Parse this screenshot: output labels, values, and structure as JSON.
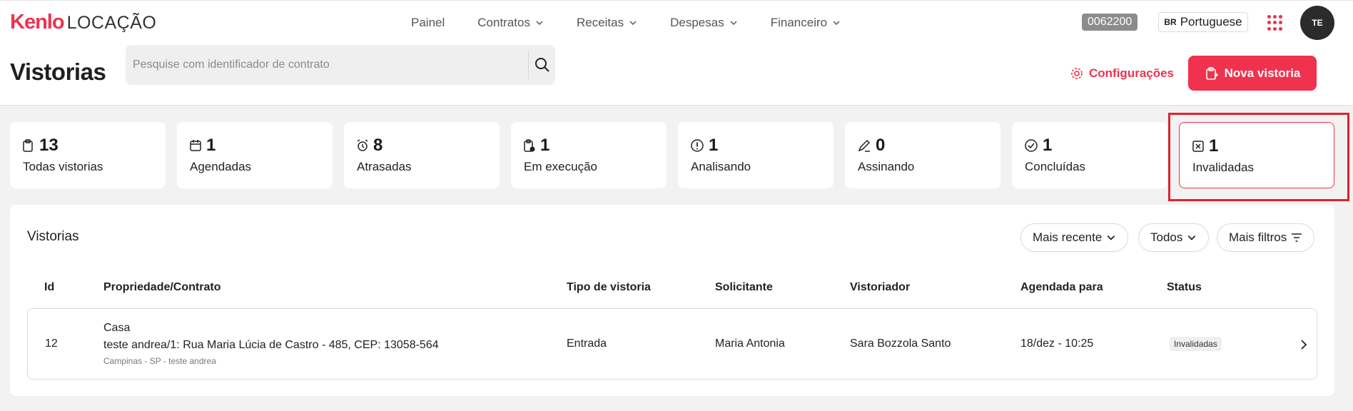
{
  "app": {
    "brand": "Kenlo",
    "product": "LOCAÇÃO"
  },
  "nav": [
    {
      "label": "Painel",
      "dropdown": false
    },
    {
      "label": "Contratos",
      "dropdown": true
    },
    {
      "label": "Receitas",
      "dropdown": true
    },
    {
      "label": "Despesas",
      "dropdown": true
    },
    {
      "label": "Financeiro",
      "dropdown": true
    }
  ],
  "account": {
    "code": "0062200",
    "language_flag": "BR",
    "language": "Portuguese",
    "avatar_initials": "TE"
  },
  "page": {
    "title": "Vistorias"
  },
  "search": {
    "placeholder": "Pesquise com identificador de contrato",
    "value": ""
  },
  "actions": {
    "config_label": "Configurações",
    "new_label": "Nova vistoria"
  },
  "summary": [
    {
      "count": "13",
      "label": "Todas vistorias",
      "icon": "clipboard-icon"
    },
    {
      "count": "1",
      "label": "Agendadas",
      "icon": "calendar-icon"
    },
    {
      "count": "8",
      "label": "Atrasadas",
      "icon": "alarm-icon"
    },
    {
      "count": "1",
      "label": "Em execução",
      "icon": "clipboard-clock-icon"
    },
    {
      "count": "1",
      "label": "Analisando",
      "icon": "alert-circle-icon"
    },
    {
      "count": "0",
      "label": "Assinando",
      "icon": "signature-icon"
    },
    {
      "count": "1",
      "label": "Concluídas",
      "icon": "check-circle-icon"
    },
    {
      "count": "1",
      "label": "Invalidadas",
      "icon": "x-square-icon"
    }
  ],
  "panel": {
    "title": "Vistorias",
    "filters": {
      "sort": "Mais recente",
      "scope": "Todos",
      "more": "Mais filtros"
    },
    "columns": [
      "Id",
      "Propriedade/Contrato",
      "Tipo de vistoria",
      "Solicitante",
      "Vistoriador",
      "Agendada para",
      "Status"
    ],
    "rows": [
      {
        "id": "12",
        "property": "Casa",
        "contract": "teste andrea/1: Rua Maria Lúcia de Castro - 485, CEP: 13058-564",
        "location": "Campinas - SP - teste andrea",
        "type": "Entrada",
        "requester": "Maria Antonia",
        "inspector": "Sara Bozzola Santo",
        "scheduled": "18/dez - 10:25",
        "status": "Invalidadas"
      }
    ]
  },
  "colors": {
    "accent": "#f0324e",
    "highlight": "#e0222f"
  }
}
